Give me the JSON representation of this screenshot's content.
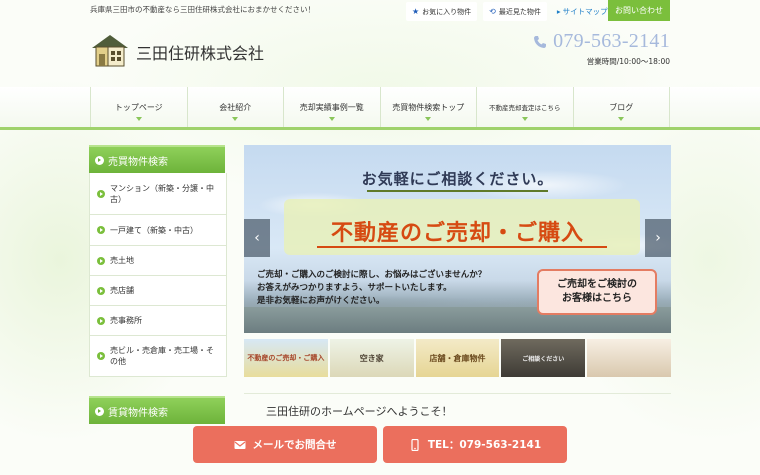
{
  "header": {
    "tagline": "兵庫県三田市の不動産なら三田住研株式会社におまかせください！",
    "favorites_label": "お気に入り物件",
    "recent_label": "最近見た物件",
    "sitemap_label": "サイトマップ",
    "contact_label": "お問い合わせ",
    "company_name": "三田住研株式会社",
    "phone": "079-563-2141",
    "hours": "営業時間/10:00～18:00"
  },
  "nav": {
    "items": [
      {
        "label": "トップページ"
      },
      {
        "label": "会社紹介"
      },
      {
        "label": "売却実績事例一覧"
      },
      {
        "label": "売買物件検索トップ"
      },
      {
        "label": "不動産売却査定はこちら"
      },
      {
        "label": "ブログ"
      }
    ]
  },
  "sidebar": {
    "sale_heading": "売買物件検索",
    "sale_items": [
      {
        "label": "マンション（新築・分譲・中古）"
      },
      {
        "label": "一戸建て（新築・中古）"
      },
      {
        "label": "売土地"
      },
      {
        "label": "売店舗"
      },
      {
        "label": "売事務所"
      },
      {
        "label": "売ビル・売倉庫・売工場・その他"
      }
    ],
    "rent_heading": "賃貸物件検索"
  },
  "banner": {
    "headline": "お気軽にご相談ください。",
    "main": "不動産のご売却・ご購入",
    "line1": "ご売却・ご購入のご検討に際し、お悩みはございませんか？",
    "line2": "お答えがみつかりますよう、サポートいたします。",
    "line3": "是非お気軽にお声がけください。",
    "cta_line1": "ご売却をご検討の",
    "cta_line2": "お客様はこちら"
  },
  "thumbnails": [
    {
      "label": "不動産のご売却・ご購入"
    },
    {
      "label": "空き家"
    },
    {
      "label": "店舗・倉庫物件"
    },
    {
      "label": "ご相談ください"
    },
    {
      "label": ""
    }
  ],
  "main": {
    "welcome": "三田住研のホームページへようこそ！"
  },
  "footer_buttons": {
    "mail_label": "メールでお問合せ",
    "tel_label": "TEL：079-563-2141"
  },
  "colors": {
    "accent_green": "#7bbf3c",
    "cta_red": "#eb6f5d",
    "phone_blue": "#a6b9dc"
  }
}
